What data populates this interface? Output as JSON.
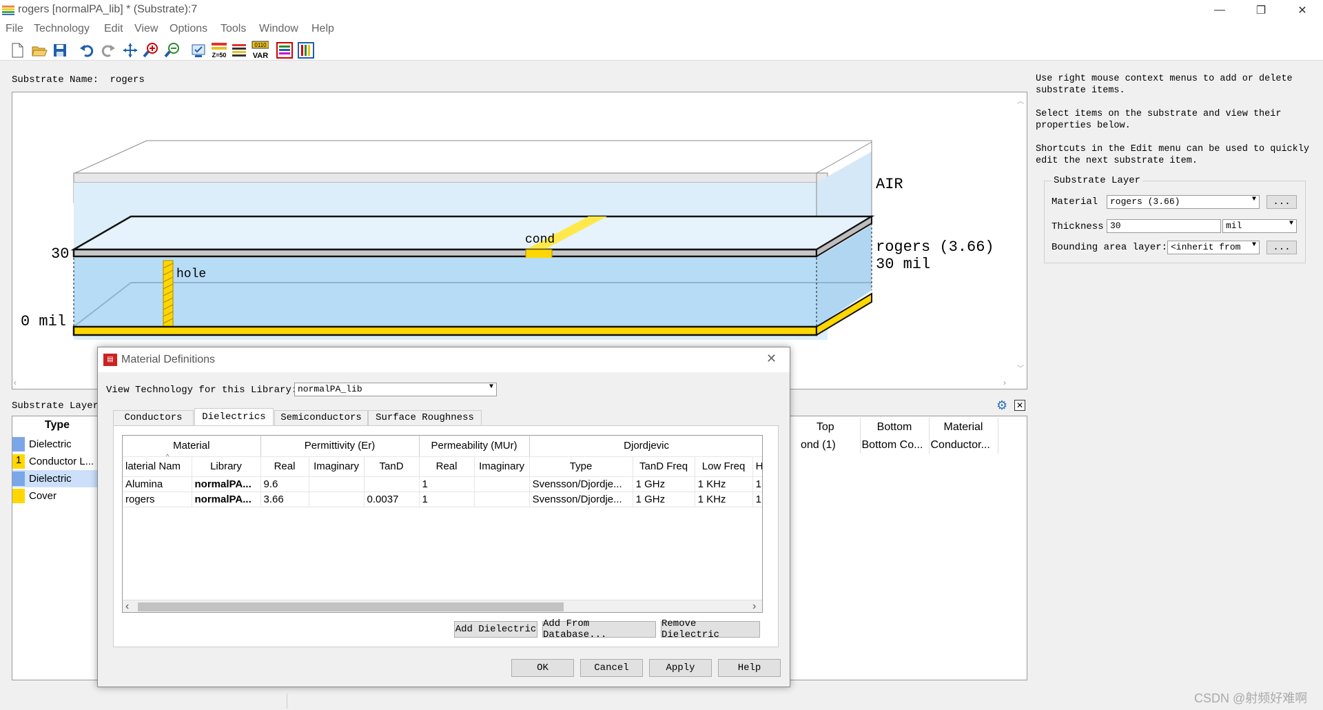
{
  "window": {
    "title": "rogers [normalPA_lib] * (Substrate):7",
    "minimize": "—",
    "restore": "❐",
    "close": "✕"
  },
  "menu": [
    "File",
    "Technology",
    "Edit",
    "View",
    "Options",
    "Tools",
    "Window",
    "Help"
  ],
  "toolbar": {
    "z50_label": "Z=50",
    "var_top": "0110",
    "var_label": "VAR"
  },
  "substrate": {
    "name_label": "Substrate Name:",
    "name_value": "rogers"
  },
  "diagram": {
    "air_label": "AIR",
    "top_tick": "30",
    "bottom_tick": "0 mil",
    "cond_label": "cond",
    "hole_label": "hole",
    "layer_material": "rogers (3.66)",
    "layer_thickness": "30 mil"
  },
  "help_text": {
    "p1": "Use right mouse context menus to add or delete substrate items.",
    "p2": "Select items on the substrate and view their properties below.",
    "p3": "Shortcuts in the Edit menu can be used to quickly edit the next substrate item."
  },
  "props": {
    "group_title": "Substrate Layer",
    "material_label": "Material",
    "material_value": "rogers (3.66)",
    "thickness_label": "Thickness",
    "thickness_value": "30",
    "thickness_unit": "mil",
    "bounding_label": "Bounding area layer:",
    "bounding_value": "<inherit from",
    "dots": "..."
  },
  "layer_table": {
    "title": "Substrate Layer",
    "type_header": "Type",
    "rows": [
      {
        "num": "",
        "type": "Dielectric",
        "color": "#7ba7e8"
      },
      {
        "num": "1",
        "type": "Conductor L...",
        "color": "#ffd700"
      },
      {
        "num": "",
        "type": "Dielectric",
        "color": "#7ba7e8"
      },
      {
        "num": "",
        "type": "Cover",
        "color": "#ffd700"
      }
    ],
    "right_headers": [
      "Top",
      "Bottom",
      "Material"
    ],
    "right_row": [
      "ond (1)",
      "Bottom Co...",
      "Conductor..."
    ]
  },
  "dialog": {
    "title": "Material Definitions",
    "close": "✕",
    "view_tech_label": "View Technology for this Library:",
    "view_tech_value": "normalPA_lib",
    "tabs": [
      "Conductors",
      "Dielectrics",
      "Semiconductors",
      "Surface Roughness"
    ],
    "active_tab": 1,
    "group_headers": [
      "Material",
      "Permittivity (Er)",
      "Permeability (MUr)",
      "Djordjevic"
    ],
    "columns": [
      "laterial Nam",
      "Library",
      "Real",
      "Imaginary",
      "TanD",
      "Real",
      "Imaginary",
      "Type",
      "TanD Freq",
      "Low Freq",
      "H"
    ],
    "rows": [
      [
        "Alumina",
        "normalPA...",
        "9.6",
        "",
        "",
        "1",
        "",
        "Svensson/Djordje...",
        "1 GHz",
        "1 KHz",
        "1"
      ],
      [
        "rogers",
        "normalPA...",
        "3.66",
        "",
        "0.0037",
        "1",
        "",
        "Svensson/Djordje...",
        "1 GHz",
        "1 KHz",
        "1"
      ]
    ],
    "add_dielectric": "Add Dielectric",
    "add_from_db": "Add From Database...",
    "remove_dielectric": "Remove Dielectric",
    "ok": "OK",
    "cancel": "Cancel",
    "apply": "Apply",
    "help": "Help"
  },
  "watermark": "CSDN @射频好难啊"
}
